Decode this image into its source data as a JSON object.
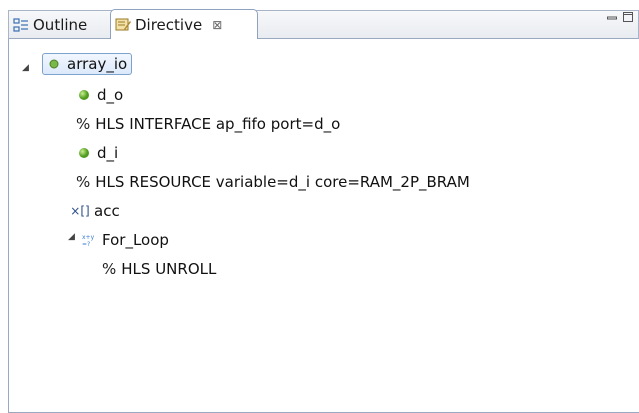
{
  "tabs": {
    "outline_label": "Outline",
    "directive_label": "Directive",
    "close_symbol": "⊠"
  },
  "view_controls": {
    "minimize_symbol": "▭",
    "maximize_symbol": "▭"
  },
  "tree": {
    "root": {
      "label": "array_io",
      "icon": "green-dot-icon",
      "expanded": true
    },
    "items": [
      {
        "label": "d_o",
        "icon": "green-ball-icon"
      },
      {
        "prefix": "%",
        "label": "HLS INTERFACE ap_fifo port=d_o",
        "icon": "percent-icon"
      },
      {
        "label": "d_i",
        "icon": "green-ball-icon"
      },
      {
        "prefix": "%",
        "label": "HLS RESOURCE variable=d_i core=RAM_2P_BRAM",
        "icon": "percent-icon"
      },
      {
        "label": "acc",
        "icon": "array-variable-icon",
        "icon_text": "×[]"
      },
      {
        "label": "For_Loop",
        "icon": "loop-icon",
        "expanded": true
      },
      {
        "prefix": "%",
        "label": "HLS UNROLL",
        "icon": "percent-icon"
      }
    ]
  }
}
